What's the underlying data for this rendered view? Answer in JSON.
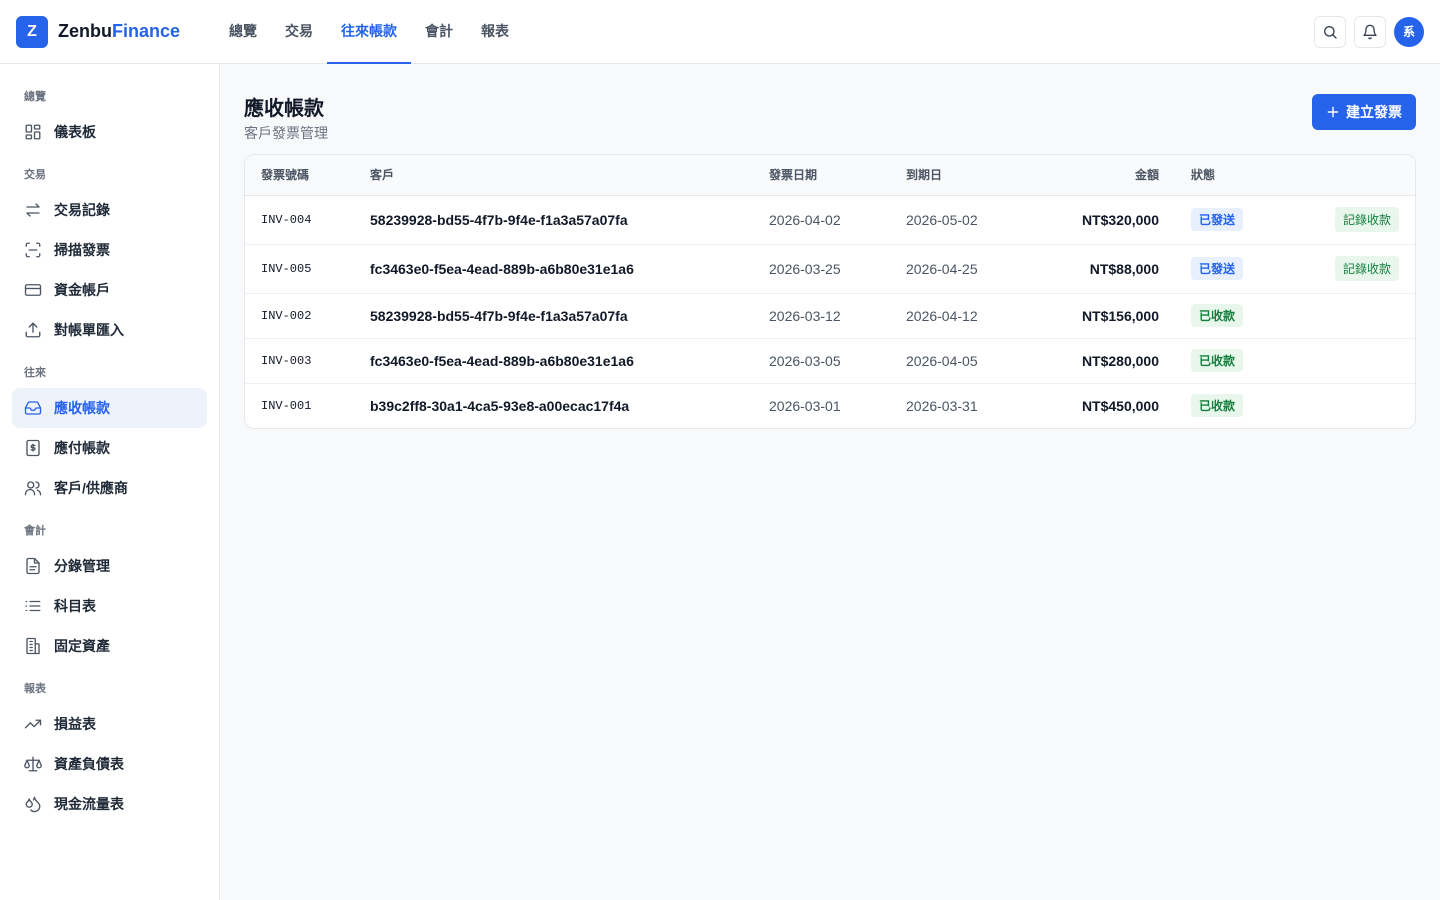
{
  "brand": {
    "logo_letter": "Z",
    "name_part1": "Zenbu",
    "name_part2": "Finance"
  },
  "topnav": [
    {
      "label": "總覽"
    },
    {
      "label": "交易"
    },
    {
      "label": "往來帳款",
      "active": true
    },
    {
      "label": "會計"
    },
    {
      "label": "報表"
    }
  ],
  "user": {
    "avatar_text": "系"
  },
  "sidebar": {
    "groups": [
      {
        "title": "總覽",
        "items": [
          {
            "label": "儀表板",
            "icon": "dashboard-icon"
          }
        ]
      },
      {
        "title": "交易",
        "items": [
          {
            "label": "交易記錄",
            "icon": "arrows-exchange-icon"
          },
          {
            "label": "掃描發票",
            "icon": "scan-icon"
          },
          {
            "label": "資金帳戶",
            "icon": "credit-card-icon"
          },
          {
            "label": "對帳單匯入",
            "icon": "upload-icon"
          }
        ]
      },
      {
        "title": "往來",
        "items": [
          {
            "label": "應收帳款",
            "icon": "inbox-icon",
            "active": true
          },
          {
            "label": "應付帳款",
            "icon": "dollar-document-icon"
          },
          {
            "label": "客戶/供應商",
            "icon": "users-icon"
          }
        ]
      },
      {
        "title": "會計",
        "items": [
          {
            "label": "分錄管理",
            "icon": "document-icon"
          },
          {
            "label": "科目表",
            "icon": "list-icon"
          },
          {
            "label": "固定資產",
            "icon": "building-icon"
          }
        ]
      },
      {
        "title": "報表",
        "items": [
          {
            "label": "損益表",
            "icon": "trending-up-icon"
          },
          {
            "label": "資產負債表",
            "icon": "scale-icon"
          },
          {
            "label": "現金流量表",
            "icon": "cash-flow-icon"
          }
        ]
      }
    ]
  },
  "page": {
    "title": "應收帳款",
    "subtitle": "客戶發票管理",
    "create_button": "建立發票"
  },
  "table": {
    "headers": {
      "number": "發票號碼",
      "customer": "客戶",
      "issue_date": "發票日期",
      "due_date": "到期日",
      "amount": "金額",
      "status": "狀態"
    },
    "rows": [
      {
        "number": "INV-004",
        "customer": "58239928-bd55-4f7b-9f4e-f1a3a57a07fa",
        "issue_date": "2026-04-02",
        "due_date": "2026-05-02",
        "amount": "NT$320,000",
        "status": "已發送",
        "status_type": "sent",
        "action": "記錄收款"
      },
      {
        "number": "INV-005",
        "customer": "fc3463e0-f5ea-4ead-889b-a6b80e31e1a6",
        "issue_date": "2026-03-25",
        "due_date": "2026-04-25",
        "amount": "NT$88,000",
        "status": "已發送",
        "status_type": "sent",
        "action": "記錄收款"
      },
      {
        "number": "INV-002",
        "customer": "58239928-bd55-4f7b-9f4e-f1a3a57a07fa",
        "issue_date": "2026-03-12",
        "due_date": "2026-04-12",
        "amount": "NT$156,000",
        "status": "已收款",
        "status_type": "paid",
        "action": ""
      },
      {
        "number": "INV-003",
        "customer": "fc3463e0-f5ea-4ead-889b-a6b80e31e1a6",
        "issue_date": "2026-03-05",
        "due_date": "2026-04-05",
        "amount": "NT$280,000",
        "status": "已收款",
        "status_type": "paid",
        "action": ""
      },
      {
        "number": "INV-001",
        "customer": "b39c2ff8-30a1-4ca5-93e8-a00ecac17f4a",
        "issue_date": "2026-03-01",
        "due_date": "2026-03-31",
        "amount": "NT$450,000",
        "status": "已收款",
        "status_type": "paid",
        "action": ""
      }
    ]
  },
  "colors": {
    "accent": "#2563eb",
    "paid": "#15803d",
    "sent_bg": "#e8effd",
    "paid_bg": "#e8f6ec"
  }
}
